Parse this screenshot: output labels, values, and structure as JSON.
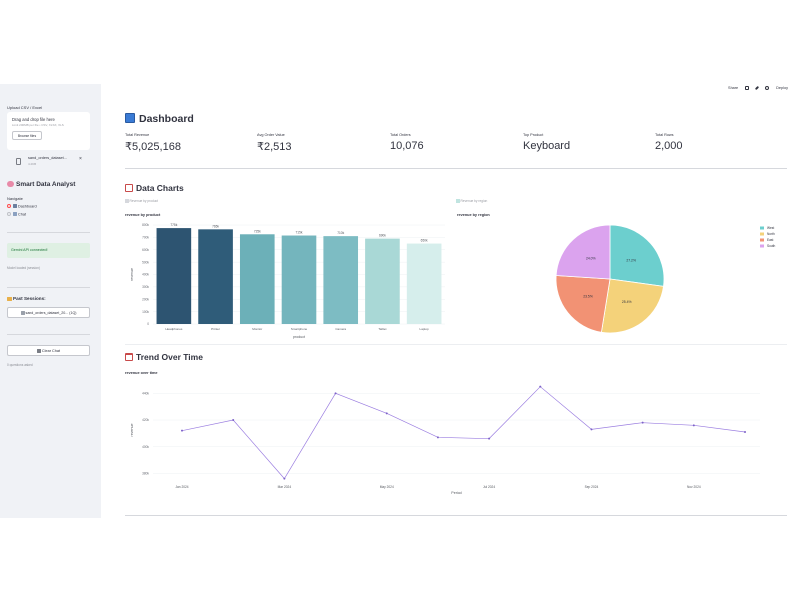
{
  "sidebar": {
    "upload_label": "Upload CSV / Excel",
    "dropzone_title": "Drag and drop file here",
    "dropzone_limit": "Limit 200MB per file • CSV, XLSX, XLS",
    "browse_label": "Browse files",
    "file_name": "sand_orders_dataset...",
    "file_size": "4.2KB",
    "app_title": "Smart Data Analyst",
    "navigate_label": "Navigate",
    "nav_items": [
      {
        "label": "Dashboard",
        "selected": true
      },
      {
        "label": "Chat",
        "selected": false
      }
    ],
    "status_message": "Gemini API connected!",
    "model_note": "Model loaded (session)",
    "past_sessions_title": "Past Sessions:",
    "session_item": "sand_orders_dataset_20... (1Q)",
    "clear_chat_label": "Clear Chat",
    "questions_note": "0 questions asked"
  },
  "toolbar": {
    "share_label": "Share",
    "deploy_label": "Deploy"
  },
  "dashboard": {
    "title": "Dashboard",
    "metrics": [
      {
        "label": "Total Revenue",
        "value": "₹5,025,168"
      },
      {
        "label": "Avg Order Value",
        "value": "₹2,513"
      },
      {
        "label": "Total Orders",
        "value": "10,076"
      },
      {
        "label": "Top Product",
        "value": "Keyboard"
      },
      {
        "label": "Total Rows",
        "value": "2,000"
      }
    ]
  },
  "charts_section": {
    "title": "Data Charts",
    "bar_toggle": "Revenue by product",
    "pie_toggle": "Revenue by region",
    "bar_title": "revenue by product",
    "pie_title": "revenue by region"
  },
  "trend_section": {
    "title": "Trend Over Time",
    "chart_title": "revenue over time"
  },
  "colors": {
    "accent": "#ff4b4b",
    "sidebar_bg": "#f0f2f6",
    "success_bg": "#dff0e3",
    "line": "#9a7de0"
  },
  "chart_data": [
    {
      "type": "bar",
      "title": "revenue by product",
      "xlabel": "product",
      "ylabel": "revenue",
      "categories": [
        "Headphones",
        "Printer",
        "Monitor",
        "Smartphone",
        "Camera",
        "Tablet",
        "Laptop"
      ],
      "values": [
        775000,
        765000,
        725000,
        715000,
        710000,
        690000,
        650000
      ],
      "data_labels": [
        "775k",
        "765k",
        "725k",
        "715k",
        "710k",
        "690k",
        "650k"
      ],
      "ylim": [
        0,
        800000
      ],
      "yticks": [
        "0",
        "100k",
        "200k",
        "300k",
        "400k",
        "500k",
        "600k",
        "700k",
        "800k"
      ],
      "colors": [
        "#2d5471",
        "#2f5c79",
        "#6cb0b8",
        "#74b5bd",
        "#7dbcc3",
        "#a9d8d6",
        "#d6eeec"
      ]
    },
    {
      "type": "pie",
      "title": "revenue by region",
      "categories": [
        "West",
        "North",
        "East",
        "South"
      ],
      "values": [
        27.2,
        25.4,
        23.5,
        24.0
      ],
      "data_labels": [
        "27.2%",
        "25.4%",
        "23.5%",
        "24.0%"
      ],
      "colors": [
        "#6ccfce",
        "#f4d27a",
        "#f29274",
        "#dba3ee"
      ],
      "legend": "right"
    },
    {
      "type": "line",
      "title": "revenue over time",
      "xlabel": "Period",
      "ylabel": "revenue",
      "x": [
        "2024-01",
        "2024-02",
        "2024-03",
        "2024-04",
        "2024-05",
        "2024-06",
        "2024-07",
        "2024-08",
        "2024-09",
        "2024-10",
        "2024-11",
        "2024-12"
      ],
      "values": [
        412000,
        420000,
        376000,
        440000,
        425000,
        407000,
        406000,
        445000,
        413000,
        418000,
        416000,
        411000
      ],
      "ylim": [
        375000,
        450000
      ],
      "yticks": [
        "380k",
        "400k",
        "420k",
        "440k"
      ],
      "xticks": [
        "Jan 2024",
        "Mar 2024",
        "May 2024",
        "Jul 2024",
        "Sep 2024",
        "Nov 2024"
      ]
    }
  ]
}
